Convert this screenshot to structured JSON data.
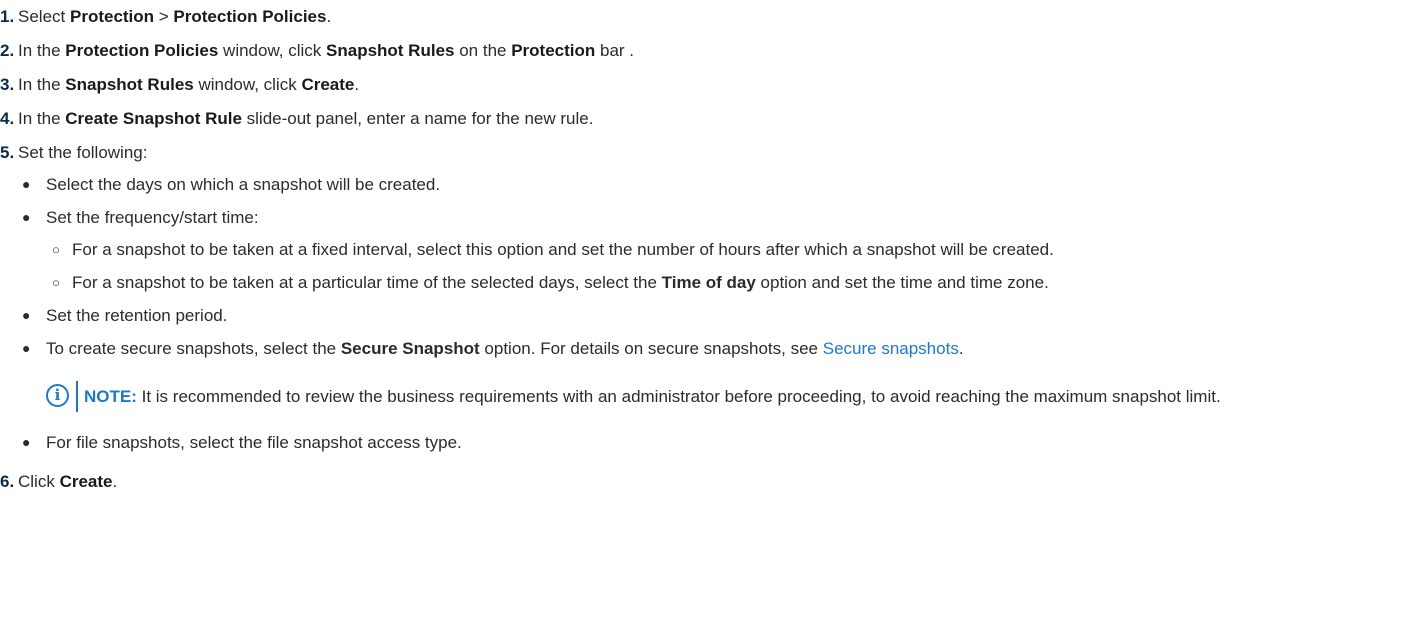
{
  "steps": [
    {
      "num": "1.",
      "parts": [
        "Select ",
        "Protection",
        " > ",
        "Protection Policies",
        "."
      ]
    },
    {
      "num": "2.",
      "parts": [
        "In the ",
        "Protection Policies",
        " window, click ",
        "Snapshot Rules",
        " on the ",
        "Protection",
        " bar ."
      ]
    },
    {
      "num": "3.",
      "parts": [
        "In the ",
        "Snapshot Rules",
        " window, click ",
        "Create",
        "."
      ]
    },
    {
      "num": "4.",
      "parts": [
        "In the ",
        "Create Snapshot Rule",
        " slide-out panel, enter a name for the new rule."
      ]
    },
    {
      "num": "5.",
      "text": "Set the following:"
    },
    {
      "num": "6.",
      "parts": [
        "Click ",
        "Create",
        "."
      ]
    }
  ],
  "bullets": {
    "days": "Select the days on which a snapshot will be created.",
    "frequency": "Set the frequency/start time:",
    "fixed_interval": "For a snapshot to be taken at a fixed interval, select this option and set the number of hours after which a snapshot will be created.",
    "time_of_day": [
      "For a snapshot to be taken at a particular time of the selected days, select the ",
      "Time of day",
      " option and set the time and time zone."
    ],
    "retention": "Set the retention period.",
    "secure": [
      "To create secure snapshots, select the ",
      "Secure Snapshot",
      " option. For details on secure snapshots, see ",
      "Secure snapshots",
      "."
    ],
    "file_access": "For file snapshots, select the file snapshot access type."
  },
  "note": {
    "label": "NOTE:",
    "text": " It is recommended to review the business requirements with an administrator before proceeding, to avoid reaching the maximum snapshot limit."
  },
  "icons": {
    "bullet": "●",
    "sub_bullet": "○",
    "info": "i"
  },
  "colors": {
    "text": "#2b2b2b",
    "link": "#1e78c8",
    "note_accent": "#1e78c8"
  }
}
